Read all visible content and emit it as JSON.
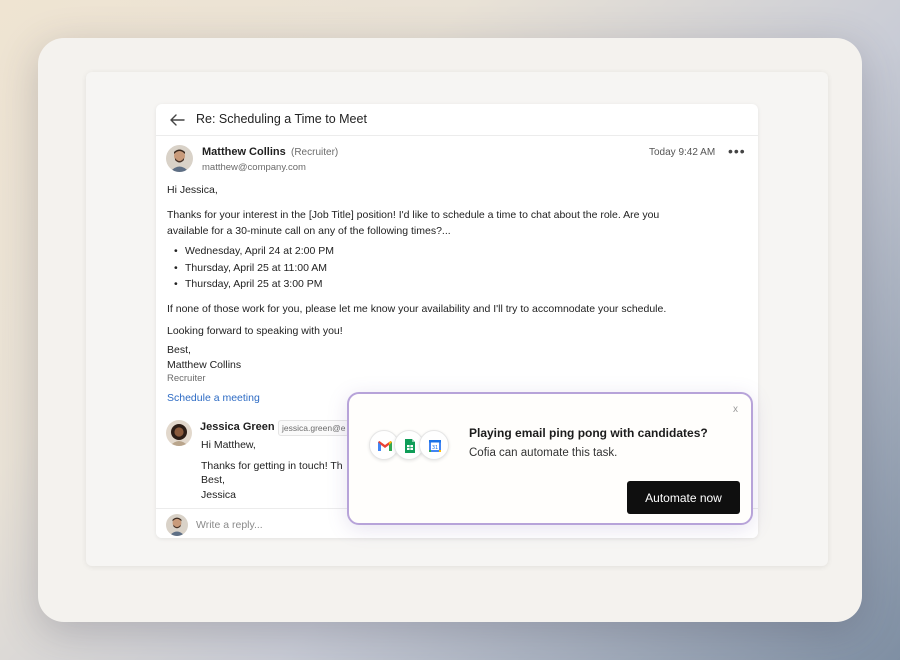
{
  "email": {
    "subject": "Re: Scheduling a Time to Meet",
    "sender": {
      "name": "Matthew Collins",
      "role": "(Recruiter)",
      "email": "matthew@company.com"
    },
    "timestamp": "Today 9:42 AM",
    "greeting": "Hi Jessica,",
    "intro_line1": "Thanks for your interest in the [Job Title] position! I'd like to schedule a time to chat about the role. Are you",
    "intro_line2": "available for a 30-minute call on any of the following times?...",
    "times": [
      "Wednesday, April 24 at 2:00 PM",
      "Thursday, April 25 at 11:00 AM",
      "Thursday, April 25 at 3:00 PM"
    ],
    "fallback": "If none of those work for you, please let me know your availability and I'll try to accomnodate your schedule.",
    "closing": "Looking forward to speaking with you!",
    "signoff": "Best,",
    "signature_name": "Matthew Collins",
    "signature_role": "Recruiter",
    "schedule_link": "Schedule a meeting"
  },
  "reply": {
    "name": "Jessica Green",
    "email": "jessica.green@e",
    "greeting": "Hi Matthew,",
    "text": "Thanks for getting in touch! Th",
    "signoff": "Best,",
    "signature": "Jessica"
  },
  "compose": {
    "placeholder": "Write a reply..."
  },
  "popup": {
    "close": "x",
    "title": "Playing email ping pong with candidates?",
    "subtitle": "Cofia can automate this task.",
    "button": "Automate now",
    "icons": [
      "gmail-icon",
      "google-sheets-icon",
      "google-calendar-icon"
    ]
  },
  "colors": {
    "link": "#2d6bc4",
    "popup_border": "#b7a3d9",
    "button_bg": "#0f0f0f"
  }
}
